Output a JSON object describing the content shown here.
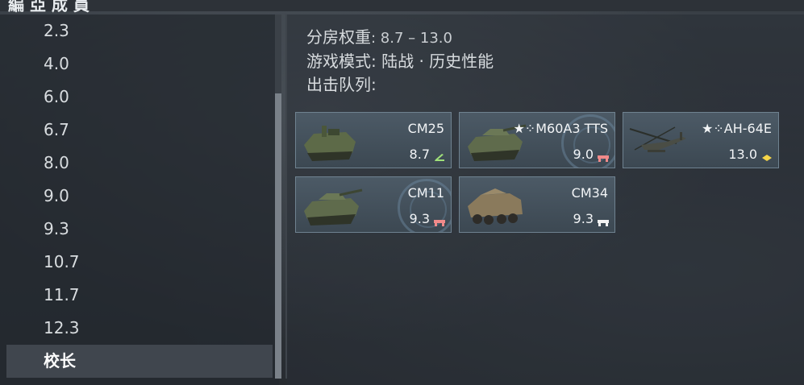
{
  "header": {
    "title": "編 亞 成 員"
  },
  "rank_list": {
    "items": [
      {
        "label": "2.3"
      },
      {
        "label": "4.0"
      },
      {
        "label": "6.0"
      },
      {
        "label": "6.7"
      },
      {
        "label": "8.0"
      },
      {
        "label": "9.0"
      },
      {
        "label": "9.3"
      },
      {
        "label": "10.7"
      },
      {
        "label": "11.7"
      },
      {
        "label": "12.3"
      },
      {
        "label": "校长",
        "selected": true
      }
    ]
  },
  "info": {
    "br_label": "分房权重",
    "br_value": "8.7 – 13.0",
    "mode_label": "游戏模式",
    "mode_value": "陆战 · 历史性能",
    "lineup_label": "出击队列"
  },
  "vehicles": [
    {
      "name": "CM25",
      "br": "8.7",
      "class_icon": "spaa-icon",
      "class_color": "#9fe07a",
      "premium": false,
      "roundel": false,
      "silhouette": "tracked-apc"
    },
    {
      "name": "M60A3 TTS",
      "br": "9.0",
      "class_icon": "tank-icon",
      "class_color": "#f08a8a",
      "premium": true,
      "roundel": true,
      "silhouette": "tank"
    },
    {
      "name": "AH-64E",
      "br": "13.0",
      "class_icon": "helicopter-icon",
      "class_color": "#f5d548",
      "premium": true,
      "roundel": false,
      "silhouette": "helicopter"
    },
    {
      "name": "CM11",
      "br": "9.3",
      "class_icon": "tank-icon",
      "class_color": "#f08a8a",
      "premium": false,
      "roundel": true,
      "silhouette": "tank"
    },
    {
      "name": "CM34",
      "br": "9.3",
      "class_icon": "light-vehicle-icon",
      "class_color": "#f2f2f2",
      "premium": false,
      "roundel": false,
      "silhouette": "wheeled"
    }
  ]
}
